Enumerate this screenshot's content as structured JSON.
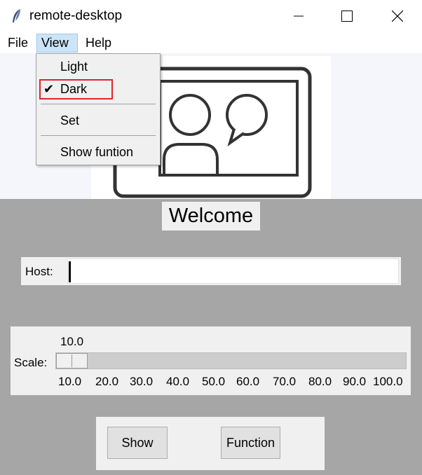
{
  "window": {
    "title": "remote-desktop",
    "app_icon": "feather-icon",
    "controls": [
      "minimize-icon",
      "maximize-icon",
      "close-icon"
    ]
  },
  "menubar": {
    "file": "File",
    "view": "View",
    "help": "Help"
  },
  "view_menu": {
    "items": [
      "Light",
      "Dark",
      "Set",
      "Show funtion"
    ],
    "checked": "Dark",
    "check_mark": "✔"
  },
  "welcome": "Welcome",
  "host": {
    "label": "Host:",
    "value": ""
  },
  "scale": {
    "label": "Scale:",
    "value": "10.0",
    "ticks": [
      "10.0",
      "20.0",
      "30.0",
      "40.0",
      "50.0",
      "60.0",
      "70.0",
      "80.0",
      "90.0",
      "100.0"
    ]
  },
  "buttons": {
    "show": "Show",
    "function": "Function"
  },
  "colors": {
    "panel_gray": "#a6a6a6",
    "highlight_red": "#e0242b",
    "menu_selected": "#cce4f7"
  }
}
